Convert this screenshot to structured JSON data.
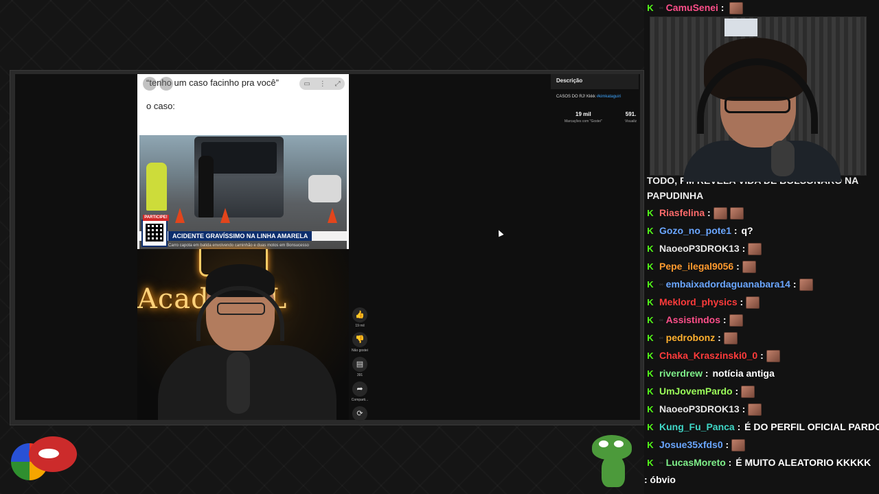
{
  "short": {
    "meme_line1": "“tenho um caso facinho pra você”",
    "meme_line2": "o caso:",
    "news_badge": "PARTICIPE!",
    "news_headline": "ACIDENTE GRAVÍSSIMO NA LINHA AMARELA",
    "news_subline": "Carro capota em batida envolvendo caminhão e duas motos em Bonsucesso",
    "neon_sign": "Acad    MBL"
  },
  "actions": {
    "like_icon": "thumb-up-icon",
    "like_count": "19 mil",
    "dislike_icon": "thumb-down-icon",
    "dislike_label": "Não gostei",
    "comment_icon": "comment-icon",
    "comment_count": "391",
    "share_icon": "share-icon",
    "share_label": "Comparti...",
    "remix_icon": "remix-icon"
  },
  "description": {
    "title": "Descrição",
    "text": "CASOS DO RJ! Kkkk ",
    "hashtag": "#kimkataguiri",
    "likes_value": "19 mil",
    "likes_label": "Marcações com \"Gostei\"",
    "views_value": "591.",
    "views_label": "Visualiz"
  },
  "chat": {
    "top_user": "CamuSenei",
    "cut_message": "TODO, PM REVELA VIDA DE BOLSONARO NA PAPUDINHA",
    "messages": [
      {
        "user": "Riasfelina",
        "color": "#ff6b6b",
        "text": "",
        "emotes": 2,
        "badge": ""
      },
      {
        "user": "Gozo_no_pote1",
        "color": "#6aa6ff",
        "text": "q?",
        "emotes": 0,
        "badge": ""
      },
      {
        "user": "NaoeoP3DROK13",
        "color": "#e6e6e6",
        "text": "",
        "emotes": 1,
        "badge": ""
      },
      {
        "user": "Pepe_ilegal9056",
        "color": "#ff9a2e",
        "text": "",
        "emotes": 1,
        "badge": ""
      },
      {
        "user": "embaixadordaguanabara14",
        "color": "#6aa6ff",
        "text": "",
        "emotes": 1,
        "badge": "sub"
      },
      {
        "user": "Meklord_physics",
        "color": "#ff3b3b",
        "text": "",
        "emotes": 1,
        "badge": ""
      },
      {
        "user": "Assistindos",
        "color": "#ff4f8a",
        "text": "",
        "emotes": 1,
        "badge": "sub"
      },
      {
        "user": "pedrobonz",
        "color": "#ffb02e",
        "text": "",
        "emotes": 1,
        "badge": "sub"
      },
      {
        "user": "Chaka_Kraszinski0_0",
        "color": "#ff3b3b",
        "text": "",
        "emotes": 1,
        "badge": ""
      },
      {
        "user": "riverdrew",
        "color": "#7ff08a",
        "text": "notícia antiga",
        "emotes": 0,
        "badge": ""
      },
      {
        "user": "UmJovemPardo",
        "color": "#9cff5a",
        "text": "",
        "emotes": 1,
        "badge": ""
      },
      {
        "user": "NaoeoP3DROK13",
        "color": "#e6e6e6",
        "text": "",
        "emotes": 1,
        "badge": ""
      },
      {
        "user": "Kung_Fu_Panca",
        "color": "#3fd6c6",
        "text": "É DO PERFIL OFICIAL PARDO",
        "emotes": 0,
        "badge": ""
      },
      {
        "user": "Josue35xfds0",
        "color": "#6aa6ff",
        "text": "",
        "emotes": 1,
        "badge": ""
      },
      {
        "user": "LucasMoreto",
        "color": "#7ff08a",
        "text": "É MUITO ALEATORIO KKKKK",
        "emotes": 0,
        "badge": "sub"
      }
    ],
    "trailing": ": óbvio"
  },
  "colors": {
    "kick_green": "#53fc18",
    "link_blue": "#3ea6ff",
    "news_blue": "#0c2e6d"
  }
}
